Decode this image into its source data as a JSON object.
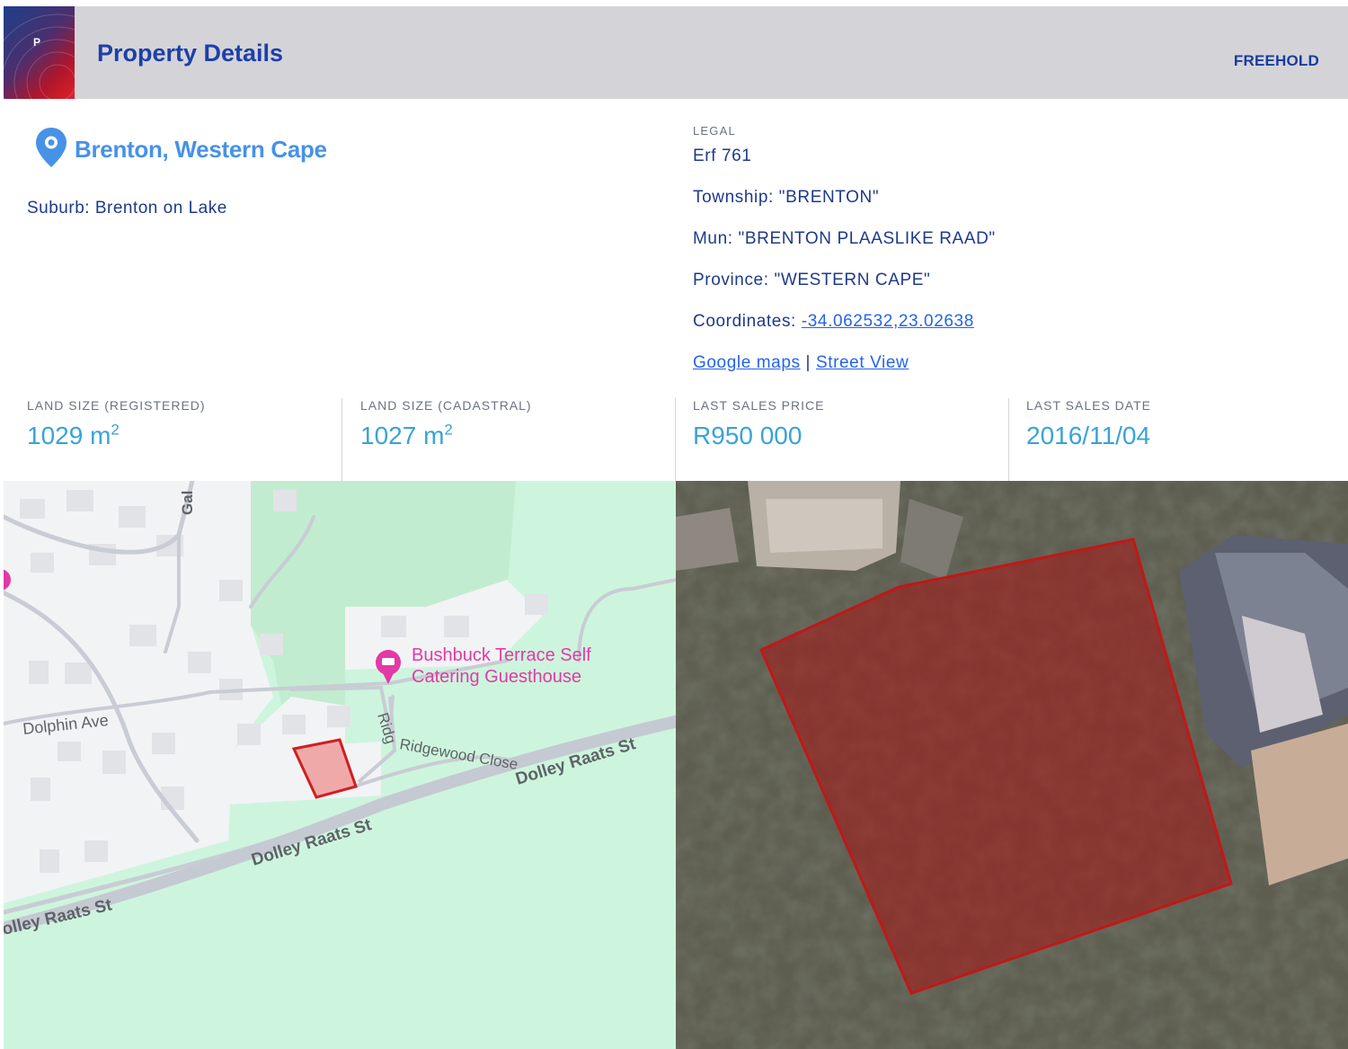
{
  "header": {
    "logo_letter": "P",
    "title": "Property Details",
    "tenure": "FREEHOLD"
  },
  "location": {
    "title": "Brenton, Western Cape",
    "suburb": "Suburb: Brenton on Lake"
  },
  "legal": {
    "label": "LEGAL",
    "erf": "Erf 761",
    "township": "Township: \"BRENTON\"",
    "mun": "Mun: \"BRENTON PLAASLIKE RAAD\"",
    "province": "Province: \"WESTERN CAPE\"",
    "coordinates_label": "Coordinates: ",
    "coordinates_value": "-34.062532,23.02638",
    "google_maps": "Google maps",
    "separator": "|",
    "street_view": "Street View"
  },
  "stats": [
    {
      "label": "LAND SIZE (REGISTERED)",
      "value": "1029 m",
      "sup": "2"
    },
    {
      "label": "LAND SIZE (CADASTRAL)",
      "value": "1027 m",
      "sup": "2"
    },
    {
      "label": "LAST SALES PRICE",
      "value": "R950 000",
      "sup": ""
    },
    {
      "label": "LAST SALES DATE",
      "value": "2016/11/04",
      "sup": ""
    }
  ],
  "street_map": {
    "streets": {
      "dolphin": "Dolphin Ave",
      "ridgewood": "Ridgewood Close",
      "dolley_1": "Dolley Raats St",
      "dolley_2": "Dolley Raats St",
      "dolley_3": "olley Raats St",
      "gal": "Gal"
    },
    "poi_line1": "Bushbuck Terrace Self",
    "poi_line2": "Catering Guesthouse"
  },
  "colors": {
    "header_bg": "#d4d4d8",
    "title_blue": "#1d3fa8",
    "location_blue": "#4792e6",
    "stat_value": "#3aa3d6",
    "parcel_red": "#d42a2a",
    "poi_pink": "#e23aa6"
  }
}
